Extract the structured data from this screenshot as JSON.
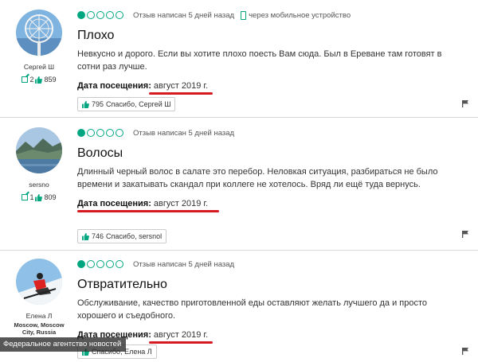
{
  "colors": {
    "accent": "#00a680",
    "underline": "#d71920"
  },
  "reviews": [
    {
      "user": "Сергей Ш",
      "reviews_count": "2",
      "helpful_count": "859",
      "rating": 1,
      "written": "Отзыв написан 5 дней назад",
      "via": "через мобильное устройство",
      "title": "Плохо",
      "text": "Невкусно и дорого. Если вы хотите плохо поесть Вам сюда. Был в Ереване там готовят в сотни раз лучше.",
      "visit_label": "Дата посещения:",
      "visit_date": "август 2019 г.",
      "thanks_count": "795",
      "thanks_text": "Спасибо, Сергей Ш"
    },
    {
      "user": "sersno",
      "reviews_count": "1",
      "helpful_count": "809",
      "rating": 1,
      "written": "Отзыв написан 5 дней назад",
      "title": "Волосы",
      "text": "Длинный черный волос в салате это перебор. Неловкая ситуация, разбираться не было времени и закатывать скандал при коллеге не хотелось. Вряд ли ещё туда вернусь.",
      "visit_label": "Дата посещения:",
      "visit_date": "август 2019 г.",
      "thanks_count": "746",
      "thanks_text": "Спасибо, sersnol"
    },
    {
      "user": "Елена Л",
      "location": "Moscow, Moscow City, Russia",
      "reviews_count": "",
      "helpful_count": "",
      "rating": 1,
      "written": "Отзыв написан 5 дней назад",
      "title": "Отвратительно",
      "text": "Обслуживание, качество приготовленной еды оставляют желать лучшего да и просто хорошего и съедобного.",
      "visit_label": "Дата посещения:",
      "visit_date": "август 2019 г.",
      "thanks_count": "",
      "thanks_text": "Спасибо, Елена Л"
    }
  ],
  "watermark": "Федеральное агентство новостей",
  "icons": [
    "rating-bubble-icon",
    "mobile-device-icon",
    "review-count-icon",
    "thumbs-up-icon",
    "flag-icon"
  ]
}
